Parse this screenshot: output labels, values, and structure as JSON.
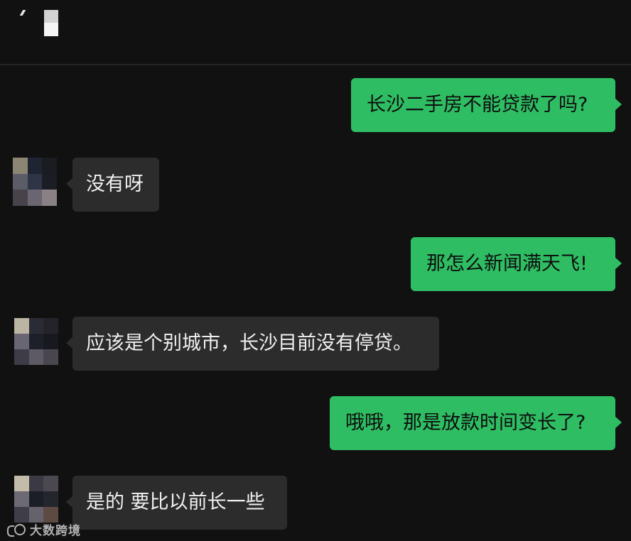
{
  "messages": [
    {
      "sender": "self",
      "text": "长沙二手房不能贷款了吗?"
    },
    {
      "sender": "other",
      "text": "没有呀"
    },
    {
      "sender": "self",
      "text": "那怎么新闻满天飞!"
    },
    {
      "sender": "other",
      "text": "应该是个别城市，长沙目前没有停贷。"
    },
    {
      "sender": "self",
      "text": "哦哦，那是放款时间变长了?"
    },
    {
      "sender": "other",
      "text": "是的 要比以前长一些"
    }
  ],
  "colors": {
    "background": "#111111",
    "outgoing_bubble": "#2fbd63",
    "incoming_bubble": "#2c2c2c"
  },
  "watermark": {
    "text": "大数跨境",
    "icon": "logo-icon"
  }
}
